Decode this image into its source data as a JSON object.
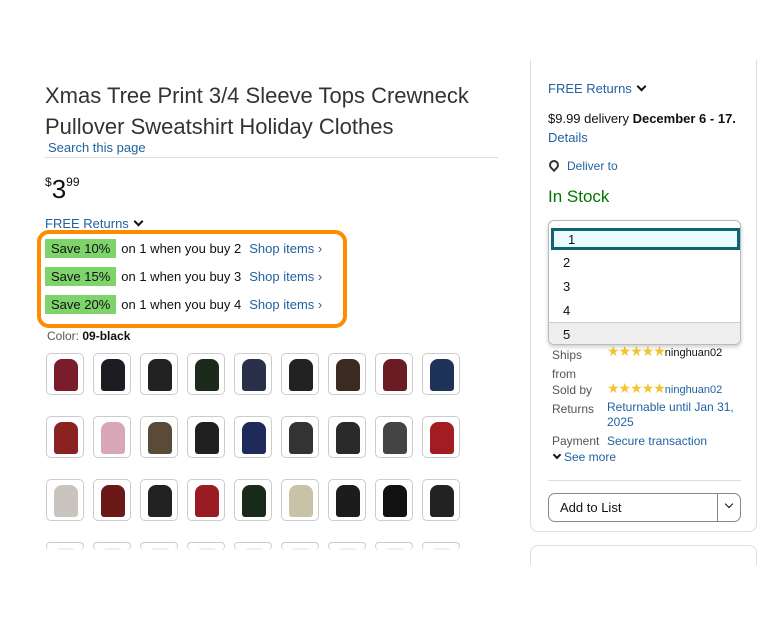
{
  "product": {
    "title": "Xmas Tree Print 3/4 Sleeve Tops Crewneck Pullover Sweatshirt Holiday Clothes",
    "search_link": "Search this page",
    "price_symbol": "$",
    "price_whole": "3",
    "price_fraction": "99",
    "free_returns": "FREE Returns",
    "color_label": "Color:",
    "color_value": "09-black"
  },
  "promos": [
    {
      "badge": "Save 10%",
      "text": "on 1 when you buy 2",
      "link": "Shop items ›"
    },
    {
      "badge": "Save 15%",
      "text": "on 1 when you buy 3",
      "link": "Shop items ›"
    },
    {
      "badge": "Save 20%",
      "text": "on 1 when you buy 4",
      "link": "Shop items ›"
    }
  ],
  "swatch_colors": [
    "#7a1c2c",
    "#1c1c22",
    "#222",
    "#1b2a1b",
    "#2a2f4a",
    "#222",
    "#3a2a22",
    "#6b1b22",
    "#1d3357",
    "#8a2222",
    "#d9a7b7",
    "#5a4a3a",
    "#202020",
    "#1f2a5a",
    "#333",
    "#2a2a2a",
    "#444",
    "#a21d22",
    "#c9c4be",
    "#6a1818",
    "#222",
    "#9a1b22",
    "#1a2a1a",
    "#c8c3a8",
    "#1c1c1c",
    "#111",
    "#222"
  ],
  "buybox": {
    "free_returns": "FREE Returns",
    "delivery_prefix": "$9.99 delivery",
    "delivery_date": "December 6 - 17.",
    "details": "Details",
    "deliver_to": "Deliver to",
    "stock": "In Stock",
    "qty_options": [
      "1",
      "2",
      "3",
      "4",
      "5"
    ],
    "ships_from_label": "Ships from",
    "ships_from_value": "ninghuan02",
    "sold_by_label": "Sold by",
    "sold_by_value": "ninghuan02",
    "returns_label": "Returns",
    "returns_value": "Returnable until Jan 31, 2025",
    "payment_label": "Payment",
    "payment_value": "Secure transaction",
    "see_more": "See more",
    "add_to_list": "Add to List",
    "stars": "★★★★★"
  },
  "colors": {
    "promo_border": "#ff8c00",
    "badge_bg": "#7fd36b",
    "in_stock": "#007600",
    "link": "#2162a1",
    "selected_option_border": "#0e6472"
  }
}
